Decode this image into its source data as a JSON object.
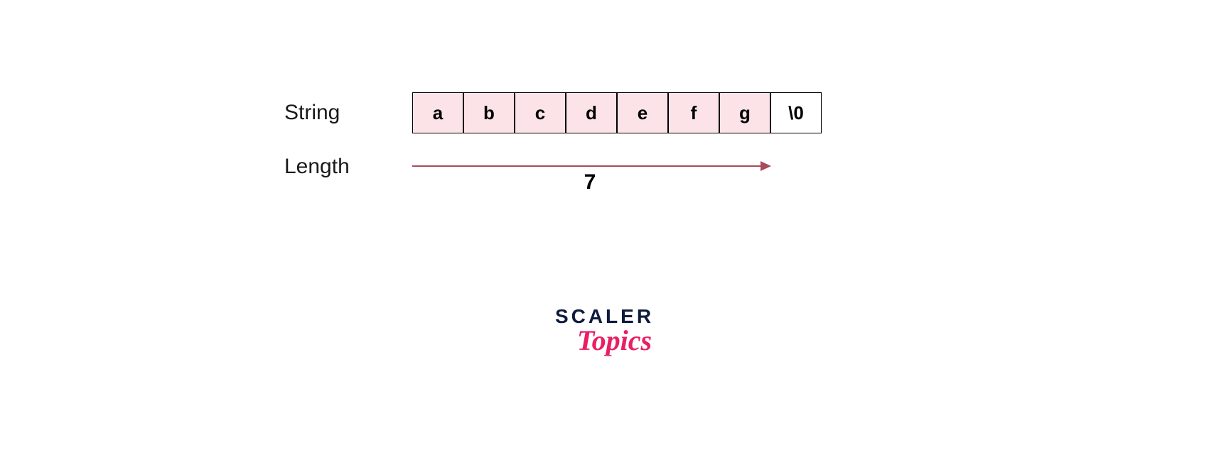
{
  "labels": {
    "string": "String",
    "length": "Length"
  },
  "cells": [
    "a",
    "b",
    "c",
    "d",
    "e",
    "f",
    "g",
    "\\0"
  ],
  "length_value": "7",
  "logo": {
    "line1": "SCALER",
    "line2": "Topics"
  },
  "colors": {
    "cell_fill": "#fbe3e8",
    "arrow": "#a84b5a",
    "logo_primary": "#0f1b3d",
    "logo_accent": "#e91e63"
  }
}
